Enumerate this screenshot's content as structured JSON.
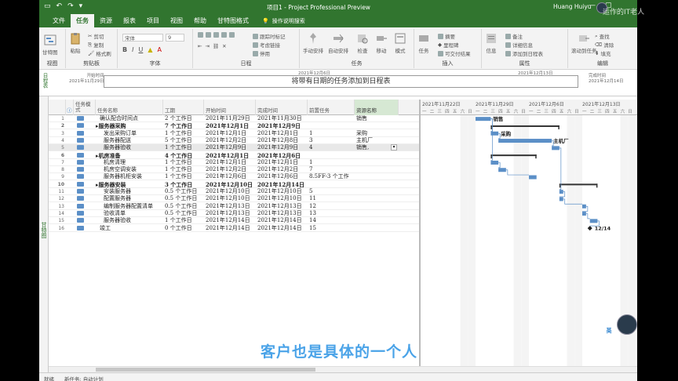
{
  "window": {
    "title": "项目1 - Project Professional Preview",
    "user": "Huang Huiyu",
    "watermark": "运作的IT老人"
  },
  "menu": {
    "items": [
      "文件",
      "任务",
      "资源",
      "报表",
      "项目",
      "视图",
      "帮助",
      "甘特图格式"
    ],
    "active_index": 1,
    "search": "操作说明搜索"
  },
  "ribbon": {
    "groups": {
      "view": "视图",
      "clipboard": "剪贴板",
      "font": "字体",
      "schedule": "日程",
      "tasks": "任务",
      "insert": "插入",
      "properties": "属性",
      "edit": "编辑"
    },
    "buttons": {
      "gantt": "甘特图",
      "paste": "粘贴",
      "cut": "剪切",
      "copy": "复制",
      "format_painter": "格式刷",
      "font_name": "宋体",
      "font_size": "9",
      "mark_on_track": "跟踪时标记",
      "respect_links": "考虑链接",
      "inactivate": "停用",
      "manual": "手动安排",
      "auto": "自动安排",
      "inspect": "检查",
      "move": "移动",
      "mode": "模式",
      "task": "任务",
      "summary": "摘要",
      "milestone": "里程碑",
      "deliverable": "可交付结果",
      "info": "信息",
      "notes": "备注",
      "details": "详细信息",
      "add_to_timeline": "添加到日程表",
      "scroll_to_task": "滚动到任务",
      "find": "查找",
      "clear": "清除",
      "fill": "填充"
    }
  },
  "timeline": {
    "label": "日程表",
    "start_label": "开始时间",
    "start_date": "2021年11月29日",
    "end_label": "完成时间",
    "end_date": "2021年12月14日",
    "placeholder": "将带有日期的任务添加到日程表",
    "mark1": "2021年12月6日",
    "mark2": "2021年12月13日"
  },
  "side_view_label": "甘特图",
  "columns": {
    "mode": "任务模式",
    "name": "任务名称",
    "duration": "工期",
    "start": "开始时间",
    "finish": "完成时间",
    "pred": "前置任务",
    "resource": "资源名称"
  },
  "tasks": [
    {
      "id": "1",
      "name": "确认配合时间点",
      "dur": "2 个工作日",
      "start": "2021年11月29日",
      "finish": "2021年11月30日",
      "pred": "",
      "res": "销售",
      "summary": false,
      "indent": 1
    },
    {
      "id": "2",
      "name": "▸服务器采购",
      "dur": "7 个工作日",
      "start": "2021年12月1日",
      "finish": "2021年12月9日",
      "pred": "",
      "res": "",
      "summary": true,
      "indent": 0
    },
    {
      "id": "3",
      "name": "发出采购订单",
      "dur": "1 个工作日",
      "start": "2021年12月1日",
      "finish": "2021年12月1日",
      "pred": "1",
      "res": "采购",
      "summary": false,
      "indent": 2
    },
    {
      "id": "4",
      "name": "服务器配送",
      "dur": "5 个工作日",
      "start": "2021年12月2日",
      "finish": "2021年12月8日",
      "pred": "3",
      "res": "主机厂",
      "summary": false,
      "indent": 2
    },
    {
      "id": "5",
      "name": "服务器验收",
      "dur": "1 个工作日",
      "start": "2021年12月9日",
      "finish": "2021年12月9日",
      "pred": "4",
      "res": "销售,",
      "summary": false,
      "indent": 2,
      "selected": true
    },
    {
      "id": "6",
      "name": "▸机房准备",
      "dur": "4 个工作日",
      "start": "2021年12月1日",
      "finish": "2021年12月6日",
      "pred": "",
      "res": "",
      "summary": true,
      "indent": 0
    },
    {
      "id": "7",
      "name": "机房清理",
      "dur": "1 个工作日",
      "start": "2021年12月1日",
      "finish": "2021年12月1日",
      "pred": "1",
      "res": "",
      "summary": false,
      "indent": 2
    },
    {
      "id": "8",
      "name": "机房空调安装",
      "dur": "1 个工作日",
      "start": "2021年12月2日",
      "finish": "2021年12月2日",
      "pred": "7",
      "res": "",
      "summary": false,
      "indent": 2
    },
    {
      "id": "9",
      "name": "服务器机柜安装",
      "dur": "1 个工作日",
      "start": "2021年12月6日",
      "finish": "2021年12月6日",
      "pred": "8.5FF-3 个工作",
      "res": "",
      "summary": false,
      "indent": 2
    },
    {
      "id": "10",
      "name": "▸服务器安装",
      "dur": "3 个工作日",
      "start": "2021年12月10日",
      "finish": "2021年12月14日",
      "pred": "",
      "res": "",
      "summary": true,
      "indent": 0
    },
    {
      "id": "11",
      "name": "安装服务器",
      "dur": "0.5 个工作日",
      "start": "2021年12月10日",
      "finish": "2021年12月10日",
      "pred": "5",
      "res": "",
      "summary": false,
      "indent": 2
    },
    {
      "id": "12",
      "name": "配置服务器",
      "dur": "0.5 个工作日",
      "start": "2021年12月10日",
      "finish": "2021年12月10日",
      "pred": "11",
      "res": "",
      "summary": false,
      "indent": 2
    },
    {
      "id": "13",
      "name": "编制服务器配置清单",
      "dur": "0.5 个工作日",
      "start": "2021年12月13日",
      "finish": "2021年12月13日",
      "pred": "12",
      "res": "",
      "summary": false,
      "indent": 2
    },
    {
      "id": "14",
      "name": "验收清单",
      "dur": "0.5 个工作日",
      "start": "2021年12月13日",
      "finish": "2021年12月13日",
      "pred": "13",
      "res": "",
      "summary": false,
      "indent": 2
    },
    {
      "id": "15",
      "name": "服务器验收",
      "dur": "1 个工作日",
      "start": "2021年12月14日",
      "finish": "2021年12月14日",
      "pred": "14",
      "res": "",
      "summary": false,
      "indent": 2
    },
    {
      "id": "16",
      "name": "竣工",
      "dur": "0 个工作日",
      "start": "2021年12月14日",
      "finish": "2021年12月14日",
      "pred": "15",
      "res": "",
      "summary": false,
      "indent": 1
    }
  ],
  "gantt": {
    "weeks": [
      "2021年11月22日",
      "2021年11月29日",
      "2021年12月6日",
      "2021年12月13日"
    ],
    "days": "一二三四五六日",
    "labels": {
      "t1": "销售",
      "t3": "采购",
      "t4": "主机厂",
      "milestone": "12/14"
    }
  },
  "status": {
    "left": "就绪",
    "new_tasks": "新任务: 自动计划"
  },
  "subtitle": "客户也是具体的一个人",
  "badge": "英",
  "colors": {
    "ribbon_green": "#31752f",
    "bar_blue": "#5b8fc7",
    "subtitle_blue": "#4aa3e8"
  }
}
